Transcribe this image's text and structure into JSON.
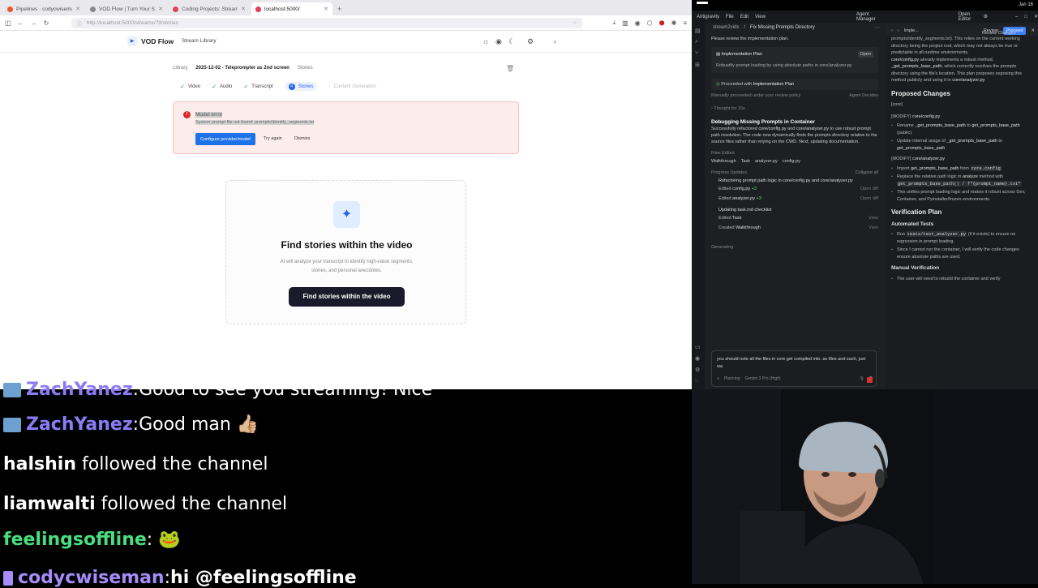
{
  "browser": {
    "tabs": [
      {
        "label": "Pipelines · codycwisema",
        "color": "#e55a2b"
      },
      {
        "label": "VOD Flow | Turn Your Stream",
        "color": "#888888"
      },
      {
        "label": "Coding Projects: Stream",
        "color": "#e33e5a"
      },
      {
        "label": "localhost:5000/",
        "color": "#e33e5a"
      }
    ],
    "url_host": "http://localhost",
    "url_path": ":5000/streams/79/stories"
  },
  "app": {
    "brand": "VOD Flow",
    "nav_link": "Stream Library",
    "breadcrumb": {
      "root": "Library",
      "current": "2025-12-02 - Teleprompter as 2nd screen",
      "page": "Stories"
    },
    "steps": [
      "Video",
      "Audio",
      "Transcript",
      "Stories",
      "Content Generation"
    ],
    "current_step_number": "4",
    "error": {
      "title": "Model error",
      "message": "System prompt file not found: prompts/identify_segments.txt",
      "configure_label": "Configure provider/model",
      "try_label": "Try again",
      "dismiss_label": "Dismiss"
    },
    "empty": {
      "title": "Find stories within the video",
      "desc": "AI will analyze your transcript to identify high-value segments, stories, and personal anecdotes.",
      "button": "Find stories within the video"
    }
  },
  "ide": {
    "os_time": "Jan 16",
    "menu": [
      "Antigravity",
      "File",
      "Edit",
      "View"
    ],
    "agent_manager": "Agent Manager",
    "open_editor": "Open Editor",
    "crumb": "stream2vids",
    "task_title": "Fix Missing Prompts Directory",
    "chat": {
      "review_text": "Please review the implementation plan.",
      "plan_title": "Implementation Plan",
      "plan_open": "Open",
      "plan_desc": "Robustify prompt loading by using absolute paths in core/analyzer.py",
      "proceeded": "Proceeded with",
      "proceeded_doc": "Implementation Plan",
      "manually": "Manually proceeded under your review policy",
      "agent_decides": "Agent Decides",
      "thought": "Thought for 16s",
      "section_title": "Debugging Missing Prompts in Container",
      "section_body_a": "Successfully refactored",
      "section_file_a": "core/config.py",
      "section_and": "and",
      "section_file_b": "core/analyzer.py",
      "section_body_b": "to use robust prompt path resolution. The code now dynamically finds the prompts directory relative to the source files rather than relying on the CWD. Next, updating documentation.",
      "files_edited_label": "Files Edited",
      "files_edited": [
        "Walkthrough",
        "Task",
        "analyzer.py",
        "config.py"
      ],
      "progress_label": "Progress Updates",
      "collapse_all": "Collapse all",
      "progress": [
        {
          "title": "Refactoring prompt path logic in core/config.py and core/analyzer.py",
          "items": [
            {
              "verb": "Edited",
              "file": "config.py",
              "delta": "+3",
              "action": "Open diff"
            },
            {
              "verb": "Edited",
              "file": "analyzer.py",
              "delta": "+3",
              "action": "Open diff"
            }
          ]
        },
        {
          "title": "Updating task.md checklist",
          "items": [
            {
              "verb": "Edited",
              "file": "Task",
              "delta": "",
              "action": "View"
            },
            {
              "verb": "Created",
              "file": "Walkthrough",
              "delta": "",
              "action": "View"
            }
          ]
        }
      ],
      "generating": "Generating",
      "input_text": "you should note all the files in core get compiled into .so files and such, just wa",
      "mode": "Planning",
      "model": "Gemini 3 Pro (High)"
    },
    "review": {
      "tab_label": "Imple...",
      "review_label": "Review",
      "proceed_label": "Proceed",
      "review_changes": "Review Changes",
      "intro": "prompts/identify_segments.txt). This relies on the current working directory being the project root, which may not always be true or predictable in all runtime environments.",
      "intro2_file": "core/config.py",
      "intro2": "already implements a robust method,",
      "intro2_fn": "_get_prompts_base_path",
      "intro3": ", which correctly resolves the prompts directory using the file's location. This plan proposes exposing this method publicly and using it in",
      "intro3_file": "core/analyzer.py",
      "h_changes": "Proposed Changes",
      "core": "[core]",
      "modify1": "[MODIFY]",
      "modify1_file": "core/config.py",
      "m1_b1a": "Rename",
      "m1_b1_fn1": "_get_prompts_base_path",
      "m1_b1b": "to",
      "m1_b1_fn2": "get_prompts_base_path",
      "m1_b1c": "(public).",
      "m1_b2a": "Update internal usage of",
      "m1_b2_fn1": "_get_prompts_base_path",
      "m1_b2b": "to",
      "m1_b2_fn2": "get_prompts_base_path",
      "modify2": "[MODIFY]",
      "modify2_file": "core/analyzer.py",
      "m2_b1a": "Import",
      "m2_b1_fn": "get_prompts_base_path",
      "m2_b1b": "from",
      "m2_b1_code": "core.config",
      "m2_b2a": "Replace the relative path logic in",
      "m2_b2_fn": "analyze",
      "m2_b2b": "method with",
      "m2_b2_code": "get_prompts_base_path() / f\"{prompt_name}.txt\"",
      "m2_b3": "This unifies prompt loading logic and makes it robust across Dev, Container, and Pyinstaller/frozen environments.",
      "h_verify": "Verification Plan",
      "h_auto": "Automated Tests",
      "t1a": "Run",
      "t1_code": "tests/test_analyzer.py",
      "t1b": "(if it exists) to ensure no regression in prompt loading.",
      "t2": "Since I cannot run the container, I will verify the code changes ensure absolute paths are used.",
      "h_manual": "Manual Verification",
      "manual_1": "The user will need to rebuild the container and verify"
    }
  },
  "chat_overlay": {
    "lines": [
      {
        "user": "ZachYanez",
        "sep": ":",
        "msg": "Good to see you streaming! Nice",
        "color": "#8b7cf6"
      },
      {
        "user": "ZachYanez",
        "sep": ":",
        "msg": "Good man 👍🏼",
        "color": "#8b7cf6"
      },
      {
        "user": "halshin",
        "sep": "",
        "msg": "followed the channel",
        "color": "#ffffff"
      },
      {
        "user": "liamwalti",
        "sep": "",
        "msg": "followed the channel",
        "color": "#ffffff"
      },
      {
        "user": "feelingsoffline",
        "sep": ":",
        "msg": "🐸",
        "color": "#4ade80"
      },
      {
        "user": "codycwiseman",
        "sep": ":",
        "msg": "hi @feelingsoffline",
        "color": "#a78bfa"
      }
    ]
  }
}
